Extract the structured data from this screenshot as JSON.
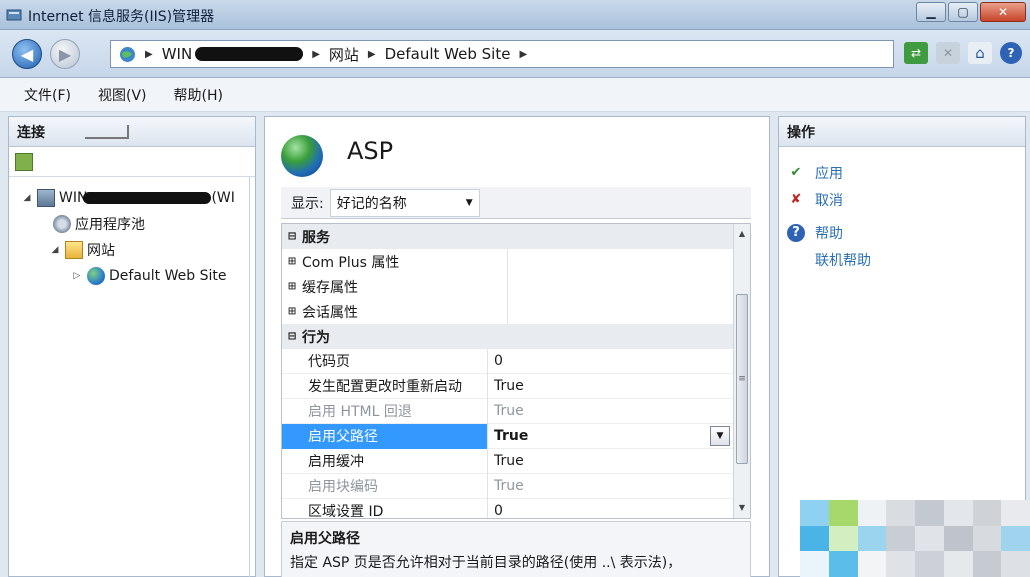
{
  "window": {
    "title": "Internet 信息服务(IIS)管理器"
  },
  "address": {
    "crumbs": [
      "WIN",
      "网站",
      "Default Web Site"
    ]
  },
  "menu": [
    "文件(F)",
    "视图(V)",
    "帮助(H)"
  ],
  "connections": {
    "header": "连接",
    "tree": [
      {
        "label": "WIN",
        "suffix": "(WI",
        "level": 0,
        "expander": "◢",
        "icon": "server-icon"
      },
      {
        "label": "应用程序池",
        "level": 1,
        "expander": "",
        "icon": "app-pool-icon"
      },
      {
        "label": "网站",
        "level": 1,
        "expander": "◢",
        "icon": "folder-icon"
      },
      {
        "label": "Default Web Site",
        "level": 2,
        "expander": "▷",
        "icon": "globe-icon"
      }
    ]
  },
  "feature": {
    "title": "ASP",
    "display_label": "显示:",
    "display_value": "好记的名称"
  },
  "grid": {
    "rows": [
      {
        "type": "cat",
        "exp": "⊟",
        "name": "服务",
        "value": ""
      },
      {
        "type": "collapsed",
        "exp": "⊞",
        "name": "Com Plus 属性",
        "value": ""
      },
      {
        "type": "collapsed",
        "exp": "⊞",
        "name": "缓存属性",
        "value": ""
      },
      {
        "type": "collapsed",
        "exp": "⊞",
        "name": "会话属性",
        "value": ""
      },
      {
        "type": "cat",
        "exp": "⊟",
        "name": "行为",
        "value": ""
      },
      {
        "type": "prop",
        "name": "代码页",
        "value": "0"
      },
      {
        "type": "prop",
        "name": "发生配置更改时重新启动",
        "value": "True"
      },
      {
        "type": "prop disabled",
        "name": "启用 HTML 回退",
        "value": "True"
      },
      {
        "type": "prop selected",
        "name": "启用父路径",
        "value": "True"
      },
      {
        "type": "prop",
        "name": "启用缓冲",
        "value": "True"
      },
      {
        "type": "prop disabled",
        "name": "启用块编码",
        "value": "True"
      },
      {
        "type": "prop",
        "name": "区域设置 ID",
        "value": "0"
      }
    ]
  },
  "description": {
    "title": "启用父路径",
    "text": "指定 ASP 页是否允许相对于当前目录的路径(使用 ..\\ 表示法)，"
  },
  "actions": {
    "header": "操作",
    "apply": "应用",
    "cancel": "取消",
    "help": "帮助",
    "online_help": "联机帮助"
  },
  "colors": {
    "selected_row": "#3399ff",
    "link": "#2a6fb5",
    "frame": "#a9b8cb"
  }
}
